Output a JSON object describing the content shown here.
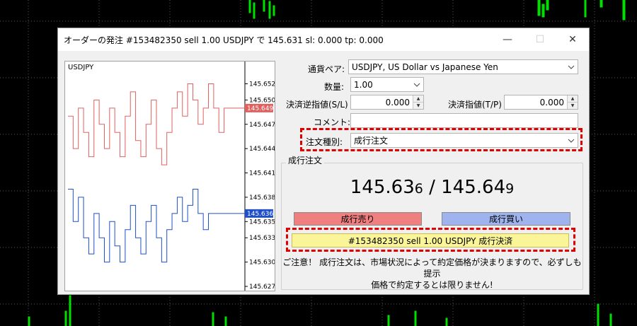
{
  "window": {
    "title": "オーダーの発注 #153482350 sell 1.00 USDJPY で 145.631 sl: 0.000 tp: 0.000",
    "minimize_glyph": "—",
    "maximize_glyph": "☐",
    "close_glyph": "✕"
  },
  "mini_chart": {
    "symbol": "USDJPY",
    "bid_line_label": "145.649",
    "ask_line_label": "145.636"
  },
  "form": {
    "currency_pair": {
      "label": "通貨ペア:",
      "value": "USDJPY, US Dollar vs Japanese Yen"
    },
    "volume": {
      "label": "数量:",
      "value": "1.00"
    },
    "stop_loss": {
      "label": "決済逆指値(S/L)",
      "value": "0.000"
    },
    "take_profit": {
      "label": "決済指値(T/P)",
      "value": "0.000"
    },
    "comment": {
      "label": "コメント:",
      "value": ""
    },
    "order_type": {
      "label": "注文種別:",
      "value": "成行注文"
    }
  },
  "market": {
    "group_title": "成行注文",
    "bid_main": "145.63",
    "bid_last": "6",
    "separator": " / ",
    "ask_main": "145.64",
    "ask_last": "9",
    "sell_button": "成行売り",
    "buy_button": "成行買い",
    "close_button": "#153482350 sell 1.00 USDJPY 成行決済",
    "notice_line1": "ご注意！ 成行注文は、市場状況によって約定価格が決まりますので、必ずしも提示",
    "notice_line2": "価格で約定するとは限りません!"
  },
  "chart_data": {
    "type": "line",
    "title": "USDJPY",
    "y_ticks": [
      "145.652",
      "145.650",
      "145.647",
      "145.644",
      "145.641",
      "145.638",
      "145.635",
      "145.633",
      "145.630",
      "145.627"
    ],
    "ylim": [
      145.627,
      145.653
    ],
    "series": [
      {
        "color": "#e06060",
        "values": [
          145.648,
          145.644,
          145.649,
          145.646,
          145.643,
          145.65,
          145.647,
          145.644,
          145.649,
          145.646,
          145.643,
          145.648,
          145.651,
          145.645,
          145.643,
          145.647,
          145.65,
          145.644,
          145.642,
          145.646,
          145.649,
          145.651,
          145.648,
          145.652,
          145.65,
          145.647,
          145.649,
          145.652,
          145.649,
          145.646,
          145.649,
          145.649,
          145.649,
          145.649,
          145.649
        ]
      },
      {
        "color": "#1f4fc8",
        "values": [
          145.639,
          145.635,
          145.638,
          145.633,
          145.631,
          145.636,
          145.633,
          145.63,
          145.635,
          145.632,
          145.63,
          145.634,
          145.637,
          145.633,
          145.631,
          145.635,
          145.637,
          145.633,
          145.63,
          145.634,
          145.636,
          145.638,
          145.635,
          145.637,
          145.639,
          145.636,
          145.634,
          145.636,
          145.636,
          145.636,
          145.636,
          145.636,
          145.636,
          145.636,
          145.636
        ]
      }
    ],
    "price_labels": [
      {
        "value": 145.649,
        "color": "#e06060"
      },
      {
        "value": 145.636,
        "color": "#1f4fc8"
      }
    ]
  }
}
